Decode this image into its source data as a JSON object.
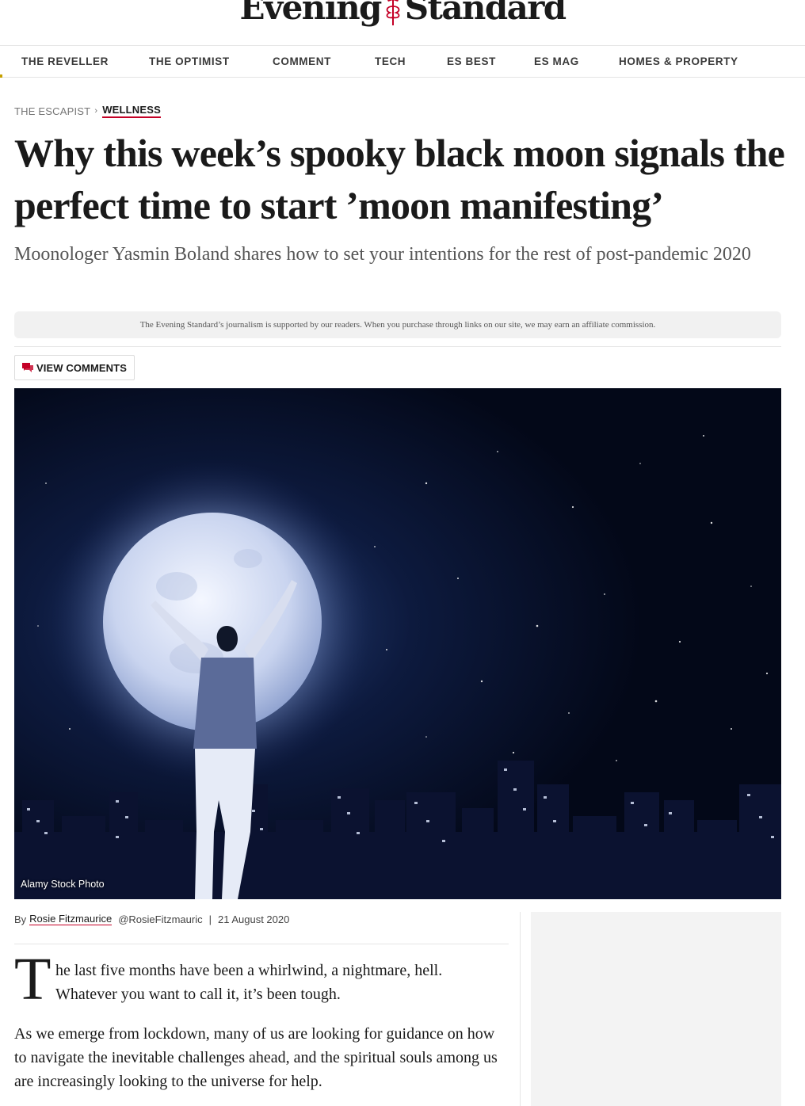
{
  "site": {
    "logo_left": "Evening",
    "logo_right": "Standard"
  },
  "nav": {
    "items": [
      "THE REVELLER",
      "THE OPTIMIST",
      "COMMENT",
      "TECH",
      "ES BEST",
      "ES MAG",
      "HOMES & PROPERTY"
    ]
  },
  "breadcrumb": {
    "section": "THE ESCAPIST",
    "separator": "›",
    "subsection": "WELLNESS"
  },
  "article": {
    "headline": "Why this week’s spooky black moon signals the perfect time to start ’moon manifesting’",
    "standfirst": "Moonologer Yasmin Boland shares how to set your intentions for the rest of post-pandemic 2020",
    "disclaimer": "The Evening Standard’s journalism is supported by our readers. When you purchase through links on our site, we may earn an affiliate commission.",
    "comments_label": "VIEW COMMENTS",
    "image_caption": "Alamy Stock Photo",
    "byline_prefix": "By",
    "author": "Rosie Fitzmaurice",
    "author_handle": "@RosieFitzmauric",
    "byline_separator": "|",
    "date": "21 August 2020",
    "dropcap": "T",
    "paragraph_1": "he last five months have been a whirlwind, a nightmare, hell. Whatever you want to call it, it’s been tough.",
    "paragraph_2": "As we emerge from lockdown, many of us are looking for guidance on how to navigate the inevitable challenges ahead, and the spiritual souls among us are increasingly looking to the universe for help."
  },
  "colors": {
    "accent_red": "#c40026",
    "text": "#1a1a1a",
    "muted": "#767676",
    "night_sky": "#040a1e"
  },
  "icons": {
    "emblem": "logo-emblem-icon",
    "comments": "speech-bubble-icon"
  }
}
